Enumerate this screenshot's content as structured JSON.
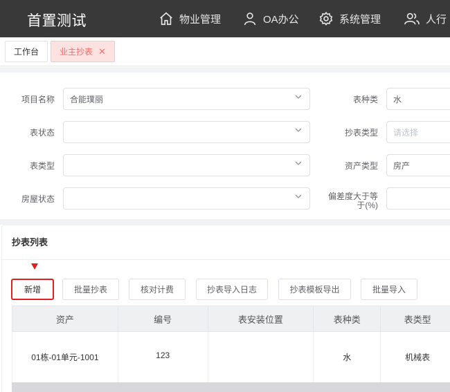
{
  "app": {
    "title": "首置测试"
  },
  "nav": [
    {
      "label": "物业管理",
      "icon": "home-icon"
    },
    {
      "label": "OA办公",
      "icon": "user-icon"
    },
    {
      "label": "系统管理",
      "icon": "gear-icon"
    },
    {
      "label": "人行",
      "icon": "users-icon"
    }
  ],
  "tabs": [
    {
      "label": "工作台",
      "active": false
    },
    {
      "label": "业主抄表",
      "active": true
    }
  ],
  "form": {
    "project_name": {
      "label": "项目名称",
      "value": "合能璞丽"
    },
    "meter_status": {
      "label": "表状态",
      "value": ""
    },
    "meter_type": {
      "label": "表类型",
      "value": ""
    },
    "room_status": {
      "label": "房屋状态",
      "value": ""
    },
    "meter_kind": {
      "label": "表种类",
      "value": "水"
    },
    "reading_type": {
      "label": "抄表类型",
      "placeholder": "请选择"
    },
    "asset_type": {
      "label": "资产类型",
      "value": "房产"
    },
    "deviation_line1": "偏差度大于等",
    "deviation_line2": "于(%)"
  },
  "list": {
    "title": "抄表列表",
    "buttons": [
      "新增",
      "批量抄表",
      "核对计费",
      "抄表导入日志",
      "抄表模板导出",
      "批量导入"
    ],
    "columns": [
      "资产",
      "编号",
      "表安装位置",
      "表种类",
      "表类型"
    ],
    "rows": [
      [
        "01栋-01单元-1001",
        "123",
        "",
        "水",
        "机械表"
      ]
    ]
  },
  "colors": {
    "accent_red": "#e02020",
    "topbar": "#393939",
    "active_tab_bg": "#fde2e2"
  }
}
